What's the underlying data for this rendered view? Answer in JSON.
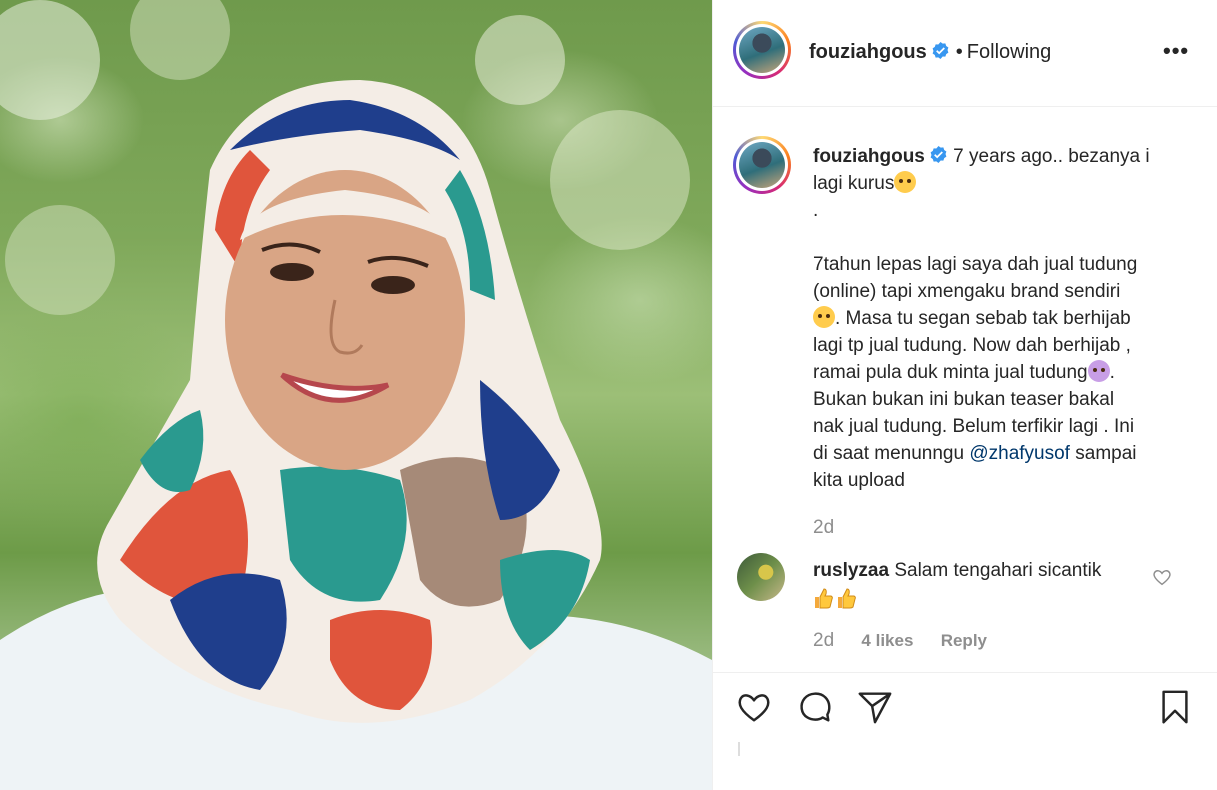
{
  "post": {
    "username": "fouziahgous",
    "follow_status": "Following",
    "separator": "•",
    "more_label": "•••"
  },
  "caption": {
    "username": "fouziahgous",
    "line1": "7 years ago.. bezanya i",
    "line2": "lagi kurus",
    "line3": ".",
    "para_lines": [
      "7tahun lepas lagi saya dah jual tudung",
      "(online) tapi xmengaku brand sendiri",
      ". Masa tu segan sebab tak berhijab",
      "lagi tp jual tudung. Now dah berhijab ,",
      "ramai pula duk minta jual tudung",
      ".",
      "Bukan bukan ini bukan teaser bakal",
      "nak jual tudung. Belum terfikir lagi . Ini",
      "di saat menunngu ",
      "sampai",
      "kita upload"
    ],
    "mention": "@zhafyusof",
    "time": "2d"
  },
  "comment": {
    "username": "ruslyzaa",
    "text": "Salam tengahari sicantik",
    "time": "2d",
    "likes": "4 likes",
    "reply": "Reply"
  },
  "colors": {
    "verified": "#3897f0",
    "mention": "#00376b",
    "meta": "#8e8e8e"
  },
  "icons": [
    "like-heart-icon",
    "comment-bubble-icon",
    "share-paper-plane-icon",
    "save-bookmark-icon"
  ]
}
